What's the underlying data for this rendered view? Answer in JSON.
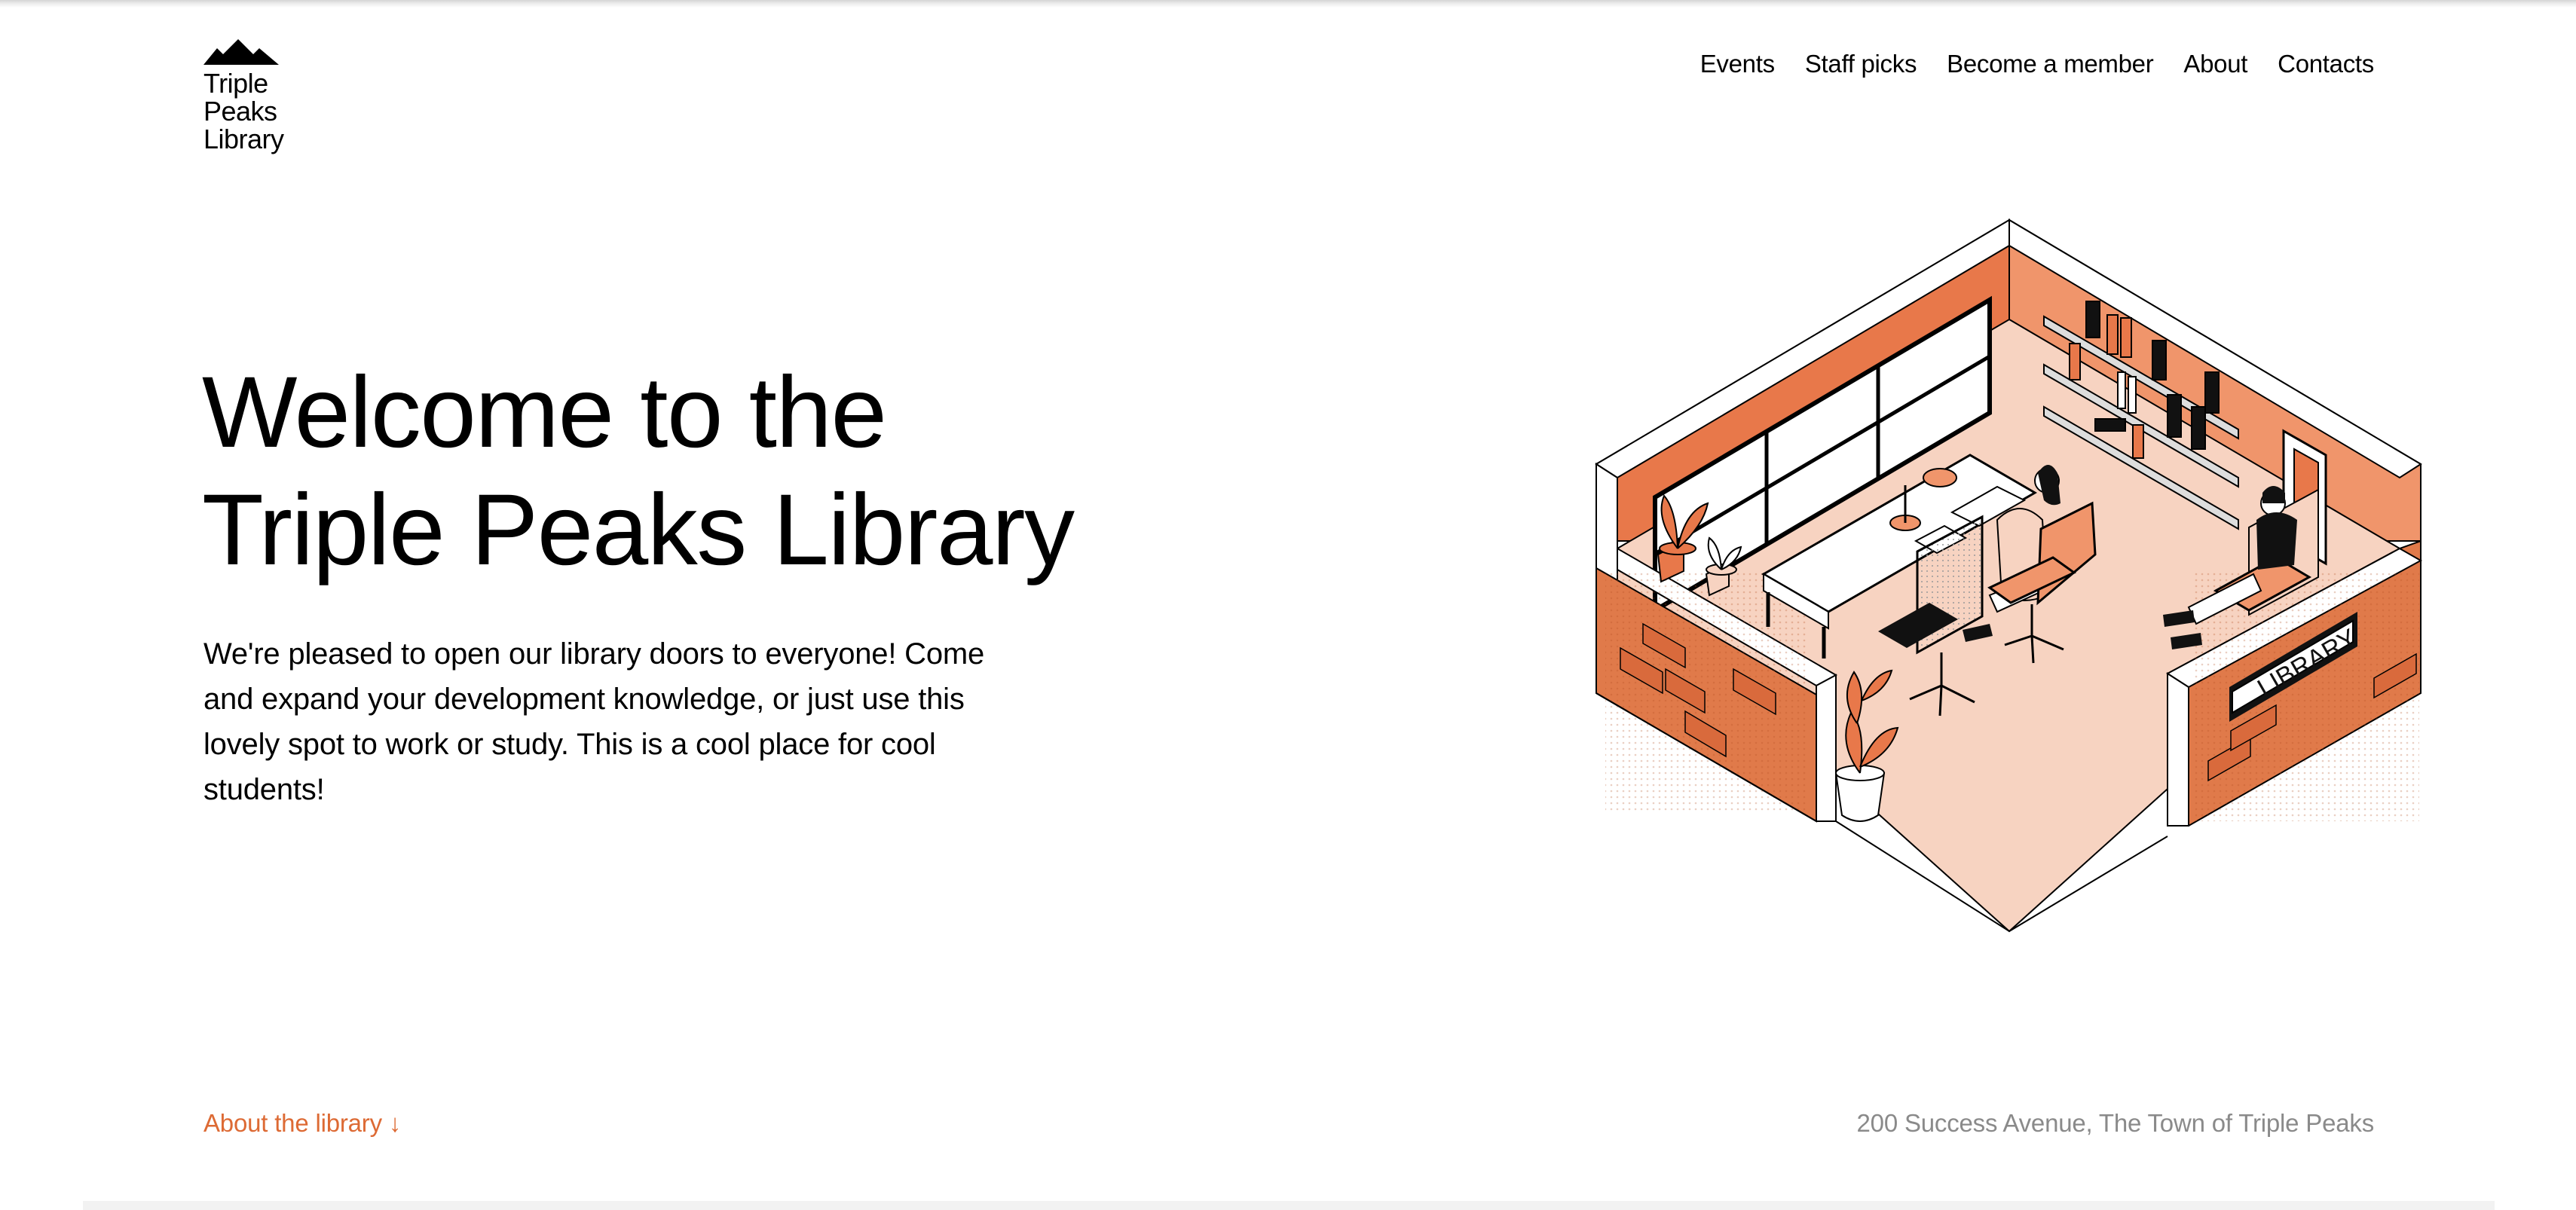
{
  "header": {
    "logo": {
      "icon": "mountain-peaks-icon",
      "lines": [
        "Triple",
        "Peaks",
        "Library"
      ]
    },
    "nav": [
      {
        "label": "Events"
      },
      {
        "label": "Staff picks"
      },
      {
        "label": "Become a member"
      },
      {
        "label": "About"
      },
      {
        "label": "Contacts"
      }
    ]
  },
  "hero": {
    "title_lines": [
      "Welcome to the",
      "Triple Peaks Library"
    ],
    "description": "We're pleased to open our library doors to everyone! Come and expand your development knowledge, or just use this lovely spot to work or study. This is a cool place for cool students!",
    "illustration": {
      "name": "isometric-library-room-illustration",
      "sign_text": "LIBRARY"
    }
  },
  "footer": {
    "about_link": "About the library ↓",
    "address": "200 Success Avenue, The Town of Triple Peaks"
  },
  "colors": {
    "accent": "#dd6a34",
    "wall_dark": "#e07a4a",
    "wall_light": "#f0956b",
    "floor": "#f7d3c1",
    "address_gray": "#8a8a8a"
  }
}
